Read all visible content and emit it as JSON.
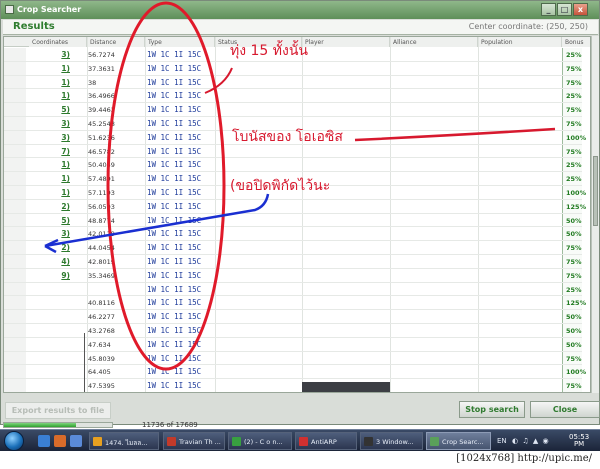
{
  "window": {
    "title": "Crop Searcher",
    "minimize": "_",
    "maximize": "□",
    "close": "x"
  },
  "results": {
    "title": "Results",
    "center_coordinate": "Center coordinate: (250, 250)"
  },
  "grid": {
    "columns": [
      "Coordinates",
      "Distance",
      "Type",
      "Status",
      "Player",
      "Alliance",
      "Population",
      "Bonus"
    ],
    "rows": [
      {
        "coord": "3)",
        "distance": "56.7274",
        "type": "1W 1C 1I 15C",
        "bonus": "25%"
      },
      {
        "coord": "1)",
        "distance": "37.3631",
        "type": "1W 1C 1I 15C",
        "bonus": "75%"
      },
      {
        "coord": "1)",
        "distance": "38",
        "type": "1W 1C 1I 15C",
        "bonus": "75%"
      },
      {
        "coord": "1)",
        "distance": "36.4966",
        "type": "1W 1C 1I 15C",
        "bonus": "25%"
      },
      {
        "coord": "5)",
        "distance": "39.4462",
        "type": "1W 1C 1I 15C",
        "bonus": "75%"
      },
      {
        "coord": "3)",
        "distance": "45.2548",
        "type": "1W 1C 1I 15C",
        "bonus": "75%"
      },
      {
        "coord": "3)",
        "distance": "51.6236",
        "type": "1W 1C 1I 15C",
        "bonus": "100%"
      },
      {
        "coord": "7)",
        "distance": "46.5782",
        "type": "1W 1C 1I 15C",
        "bonus": "75%"
      },
      {
        "coord": "1)",
        "distance": "50.4059",
        "type": "1W 1C 1I 15C",
        "bonus": "25%"
      },
      {
        "coord": "1)",
        "distance": "57.4891",
        "type": "1W 1C 1I 15C",
        "bonus": "25%"
      },
      {
        "coord": "1)",
        "distance": "57.1193",
        "type": "1W 1C 1I 15C",
        "bonus": "100%"
      },
      {
        "coord": "2)",
        "distance": "56.0593",
        "type": "1W 1C 1I 15C",
        "bonus": "125%"
      },
      {
        "coord": "5)",
        "distance": "48.8774",
        "type": "1W 1C 1I 15C",
        "bonus": "50%"
      },
      {
        "coord": "3)",
        "distance": "42.0119",
        "type": "1W 1C 1I 15C",
        "bonus": "50%"
      },
      {
        "coord": "2)",
        "distance": "44.0454",
        "type": "1W 1C 1I 15C",
        "bonus": "75%"
      },
      {
        "coord": "4)",
        "distance": "42.8019",
        "type": "1W 1C 1I 15C",
        "bonus": "75%"
      },
      {
        "coord": "9)",
        "distance": "35.3469",
        "type": "1W 1C 1I 15C",
        "bonus": "75%"
      },
      {
        "coord": "",
        "distance": "",
        "type": "1W 1C 1I 15C",
        "bonus": "25%"
      },
      {
        "coord": "",
        "distance": "40.8116",
        "type": "1W 1C 1I 15C",
        "bonus": "125%"
      },
      {
        "coord": "",
        "distance": "46.2277",
        "type": "1W 1C 1I 15C",
        "bonus": "50%"
      },
      {
        "coord": "",
        "distance": "43.2768",
        "type": "1W 1C 1I 15C",
        "bonus": "50%"
      },
      {
        "coord": "",
        "distance": "47.634",
        "type": "1W 1C 1I 15C",
        "bonus": "50%"
      },
      {
        "coord": "",
        "distance": "45.8039",
        "type": "1W 1C 1I 15C",
        "bonus": "75%"
      },
      {
        "coord": "",
        "distance": "64.405",
        "type": "1W 1C 1I 15C",
        "bonus": "100%"
      },
      {
        "coord": "",
        "distance": "47.5395",
        "type": "1W 1C 1I 15C",
        "bonus": "75%"
      }
    ]
  },
  "footer": {
    "export_label": "Export results to file",
    "stop_label": "Stop search",
    "close_label": "Close",
    "progress_text": "11736 of 17689",
    "progress_fraction": 0.6635
  },
  "taskbar": {
    "tasks": [
      {
        "label": "1474. ไมลล..."
      },
      {
        "label": "Travian Th ..."
      },
      {
        "label": "(2) - C o n..."
      },
      {
        "label": "AntiARP"
      },
      {
        "label": "3 Window..."
      },
      {
        "label": "Crop Searc..."
      }
    ],
    "lang": "EN",
    "clock_time": "05:53",
    "clock_ampm": "PM"
  },
  "caption": "[1024x768] http://upic.me/",
  "annotations": {
    "top": "ทุ่ง 15 ทั้งนั้น",
    "middle": "โบนัสของ โอเอซิส",
    "bottom": "(ขอปิดพิกัดไว้นะ"
  },
  "colors": {
    "annotation": "#d7192e",
    "arrow_blue": "#1a2fd1",
    "accent_green": "#2f7d2f"
  }
}
